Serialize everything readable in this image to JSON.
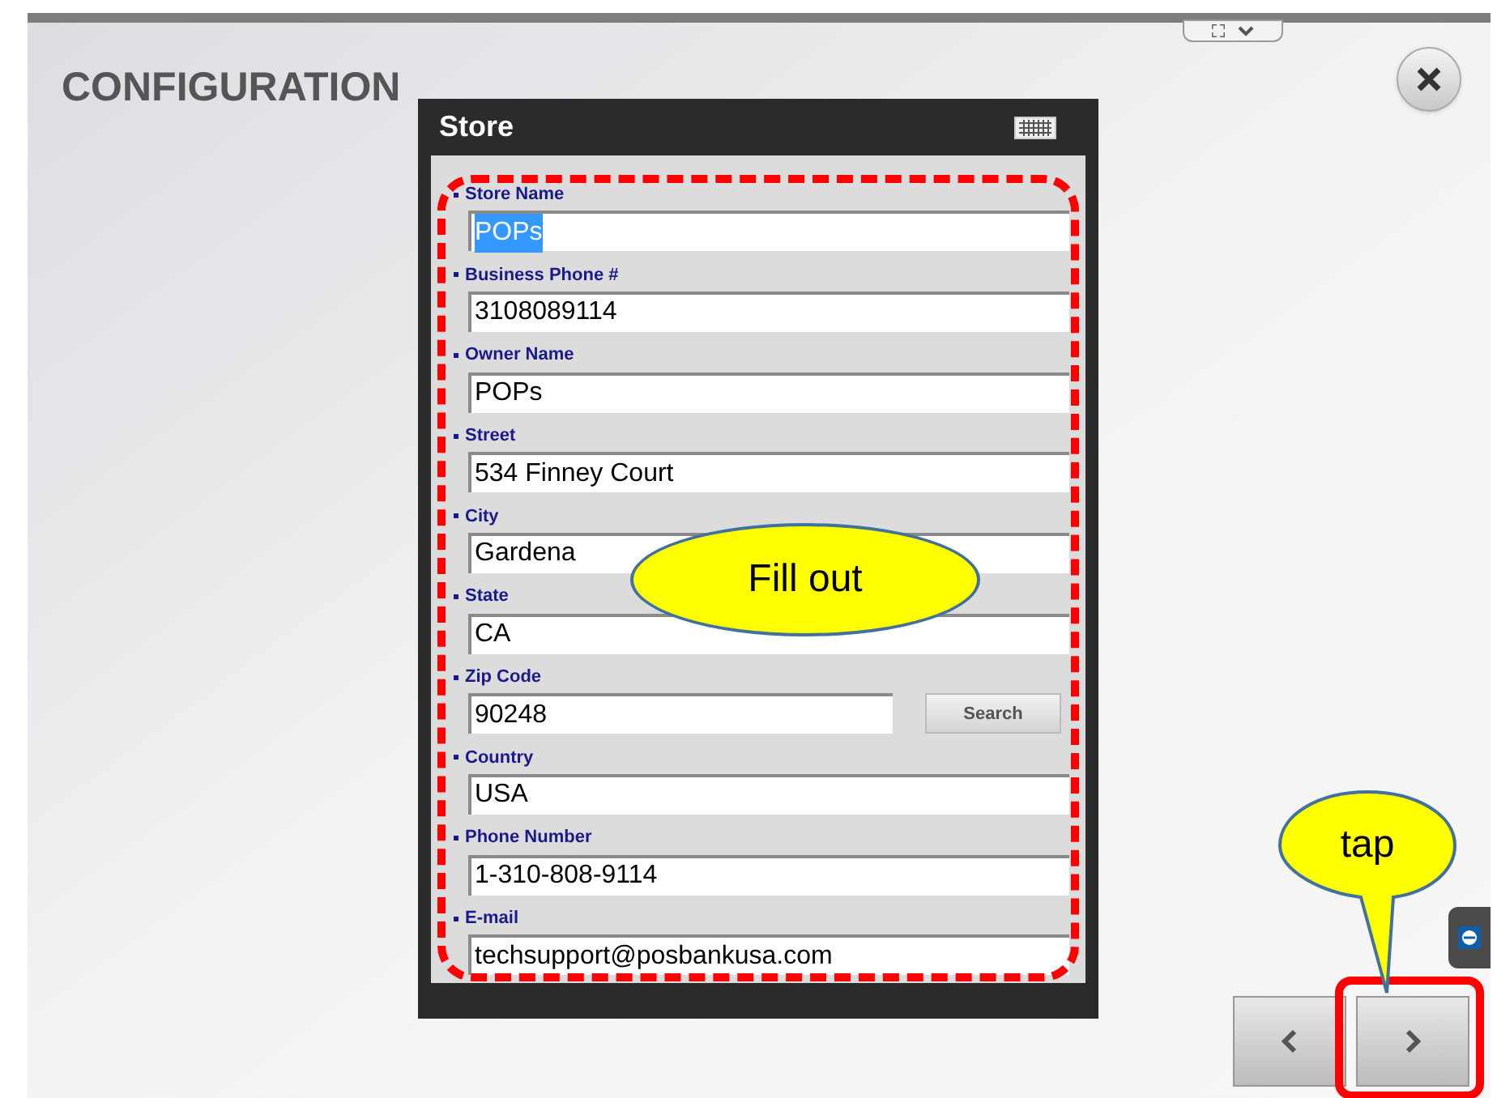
{
  "screen": {
    "title": "CONFIGURATION"
  },
  "dialog": {
    "title": "Store",
    "fields": [
      {
        "label": "Store Name",
        "value": "POPs",
        "text_selected": true
      },
      {
        "label": "Business Phone #",
        "value": "3108089114",
        "text_selected": false
      },
      {
        "label": "Owner Name",
        "value": "POPs",
        "text_selected": false
      },
      {
        "label": "Street",
        "value": "534 Finney Court",
        "text_selected": false
      },
      {
        "label": "City",
        "value": "Gardena",
        "text_selected": false
      },
      {
        "label": "State",
        "value": "CA",
        "text_selected": false
      },
      {
        "label": "Zip Code",
        "value": "90248",
        "text_selected": false,
        "button": "Search"
      },
      {
        "label": "Country",
        "value": "USA",
        "text_selected": false
      },
      {
        "label": "Phone Number",
        "value": "1-310-808-9114",
        "text_selected": false
      },
      {
        "label": "E-mail",
        "value": "techsupport@posbankusa.com",
        "text_selected": false
      }
    ]
  },
  "annotations": [
    {
      "kind": "ellipse",
      "text": "Fill out"
    },
    {
      "kind": "speech",
      "text": "tap"
    }
  ]
}
